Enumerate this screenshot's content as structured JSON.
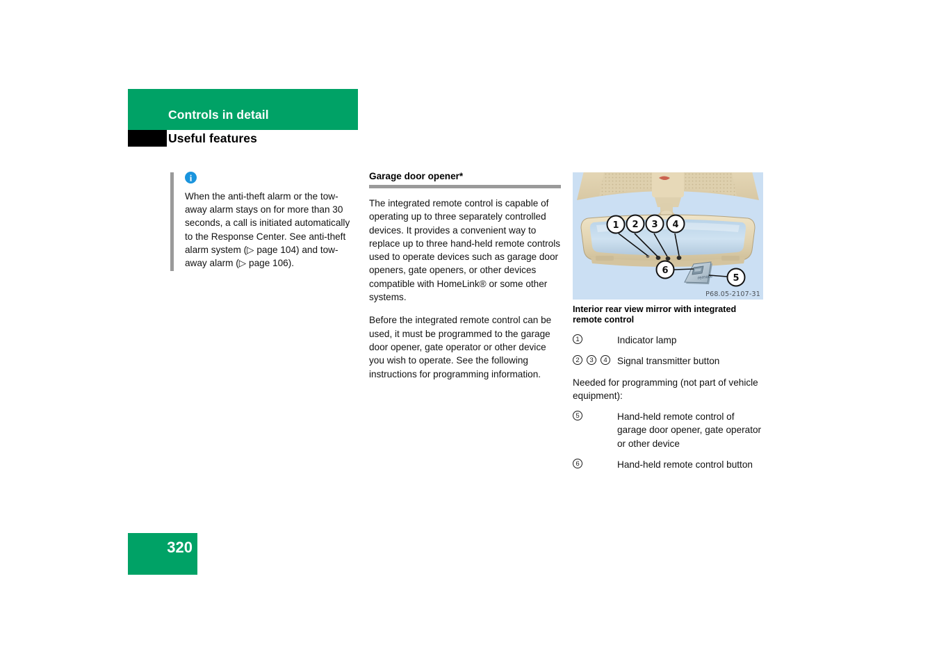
{
  "header": {
    "chapter": "Controls in detail",
    "section": "Useful features"
  },
  "note": {
    "icon": "info-icon",
    "text": "When the anti-theft alarm or the tow-away alarm stays on for more than 30 seconds, a call is initiated automatically to the Response Center. See anti-theft alarm system (▷ page 104) and tow-away alarm (▷ page 106)."
  },
  "main": {
    "heading": "Garage door opener*",
    "paragraphs": [
      "The integrated remote control is capable of operating up to three separately controlled devices. It provides a convenient way to replace up to three hand-held remote controls used to operate devices such as garage door openers, gate openers, or other devices compatible with HomeLink® or some other systems.",
      "Before the integrated remote control can be used, it must be programmed to the garage door opener, gate operator or other device you wish to operate. See the following instructions for programming information."
    ]
  },
  "figure": {
    "code": "P68.05-2107-31",
    "caption": "Interior rear view mirror with integrated remote control",
    "callouts": [
      "1",
      "2",
      "3",
      "4",
      "5",
      "6"
    ],
    "legend": [
      {
        "keys": [
          "1"
        ],
        "label": "Indicator lamp"
      },
      {
        "keys": [
          "2",
          "3",
          "4"
        ],
        "label": "Signal transmitter button"
      }
    ],
    "legend_note": "Needed for programming (not part of vehicle equipment):",
    "legend2": [
      {
        "keys": [
          "5"
        ],
        "label": "Hand-held remote control of garage door opener, gate operator or other device"
      },
      {
        "keys": [
          "6"
        ],
        "label": "Hand-held remote control button"
      }
    ]
  },
  "footer": {
    "page_number": "320"
  },
  "colors": {
    "brand_green": "#00a266",
    "rule_gray": "#9a9a9a",
    "figure_background": "#cbdff3",
    "info_blue": "#1a94dd"
  }
}
